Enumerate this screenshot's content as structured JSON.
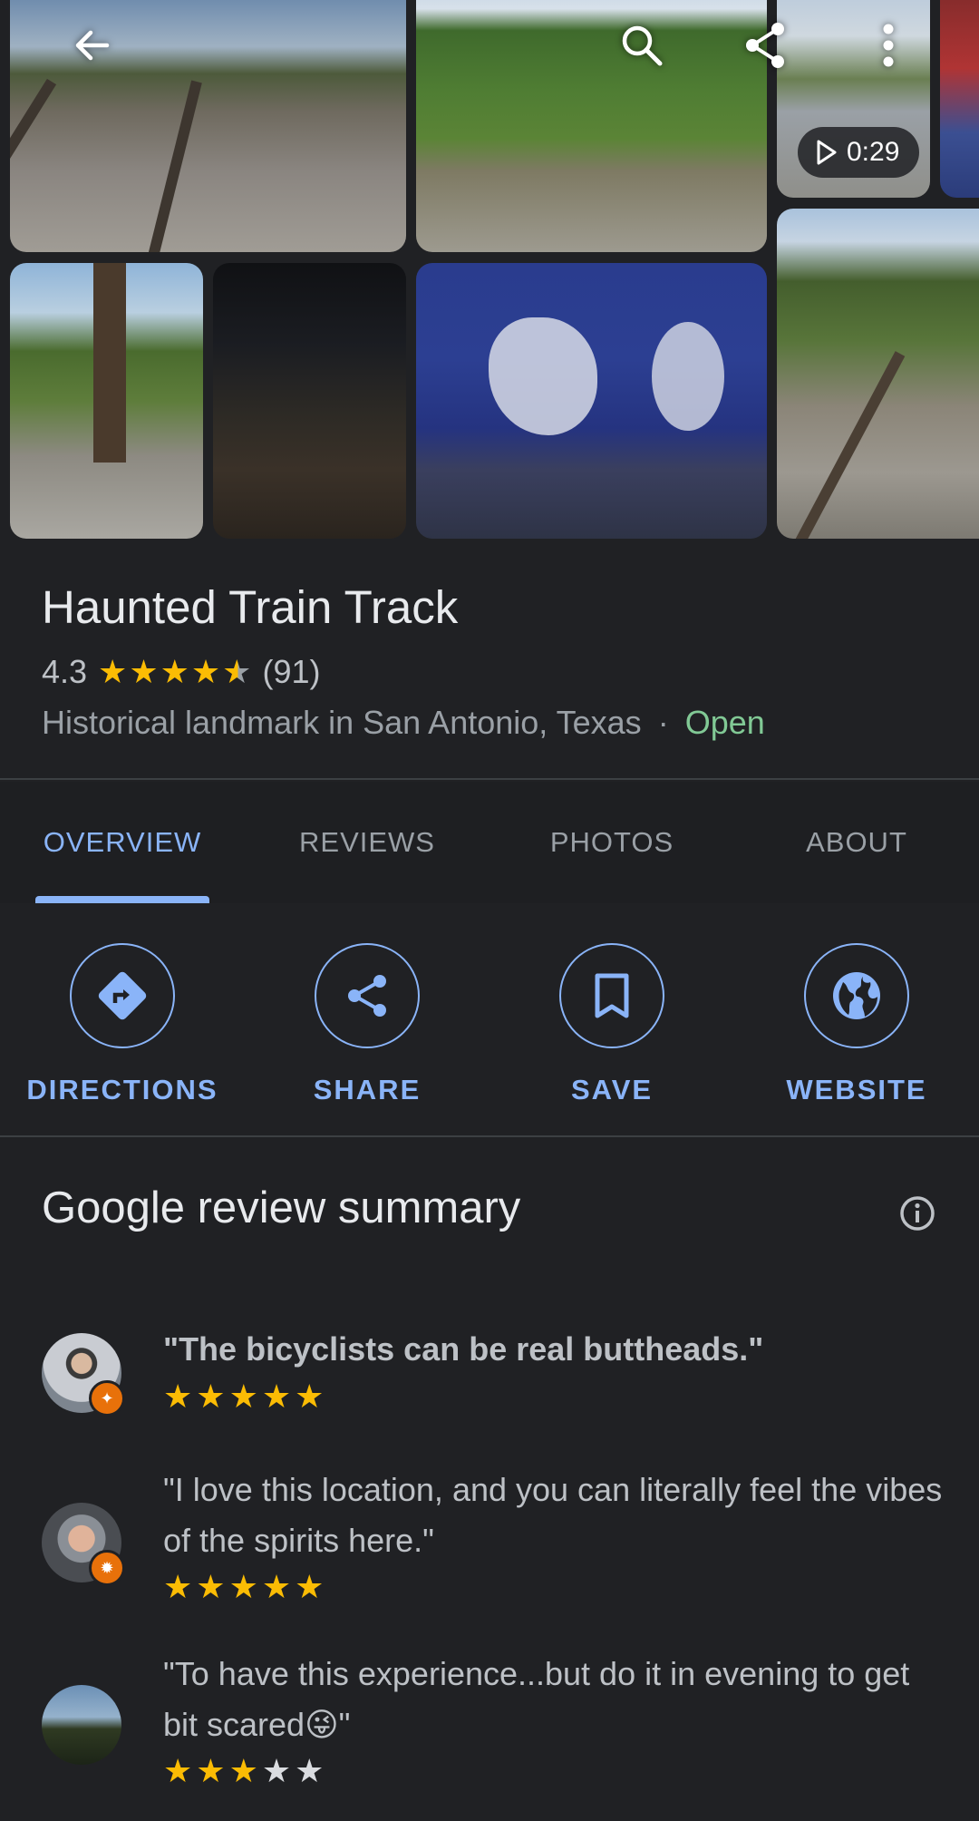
{
  "video_duration": "0:29",
  "place": {
    "name": "Haunted Train Track",
    "rating": "4.3",
    "rating_value": 4.3,
    "review_count": "(91)",
    "category": "Historical landmark in San Antonio, Texas",
    "separator": "·",
    "status": "Open",
    "status_color": "#81c995"
  },
  "tabs": [
    {
      "label": "OVERVIEW",
      "active": true
    },
    {
      "label": "REVIEWS",
      "active": false
    },
    {
      "label": "PHOTOS",
      "active": false
    },
    {
      "label": "ABOUT",
      "active": false
    }
  ],
  "actions": [
    {
      "label": "DIRECTIONS",
      "icon": "directions-icon"
    },
    {
      "label": "SHARE",
      "icon": "share-icon"
    },
    {
      "label": "SAVE",
      "icon": "bookmark-icon"
    },
    {
      "label": "WEBSITE",
      "icon": "globe-icon"
    }
  ],
  "summary": {
    "title": "Google review summary"
  },
  "reviews": [
    {
      "text": "\"The bicyclists can be real buttheads.\"",
      "stars": 5,
      "bold": true
    },
    {
      "text": "\"I love this location, and you can literally feel the vibes of the spirits here.\"",
      "stars": 5,
      "bold": false
    },
    {
      "text": "\"To have this experience...but do it in evening to get bit scared😜\"",
      "stars": 3,
      "bold": false
    }
  ],
  "colors": {
    "accent": "#8ab4f8",
    "star": "#fbbc04",
    "background": "#202124"
  }
}
